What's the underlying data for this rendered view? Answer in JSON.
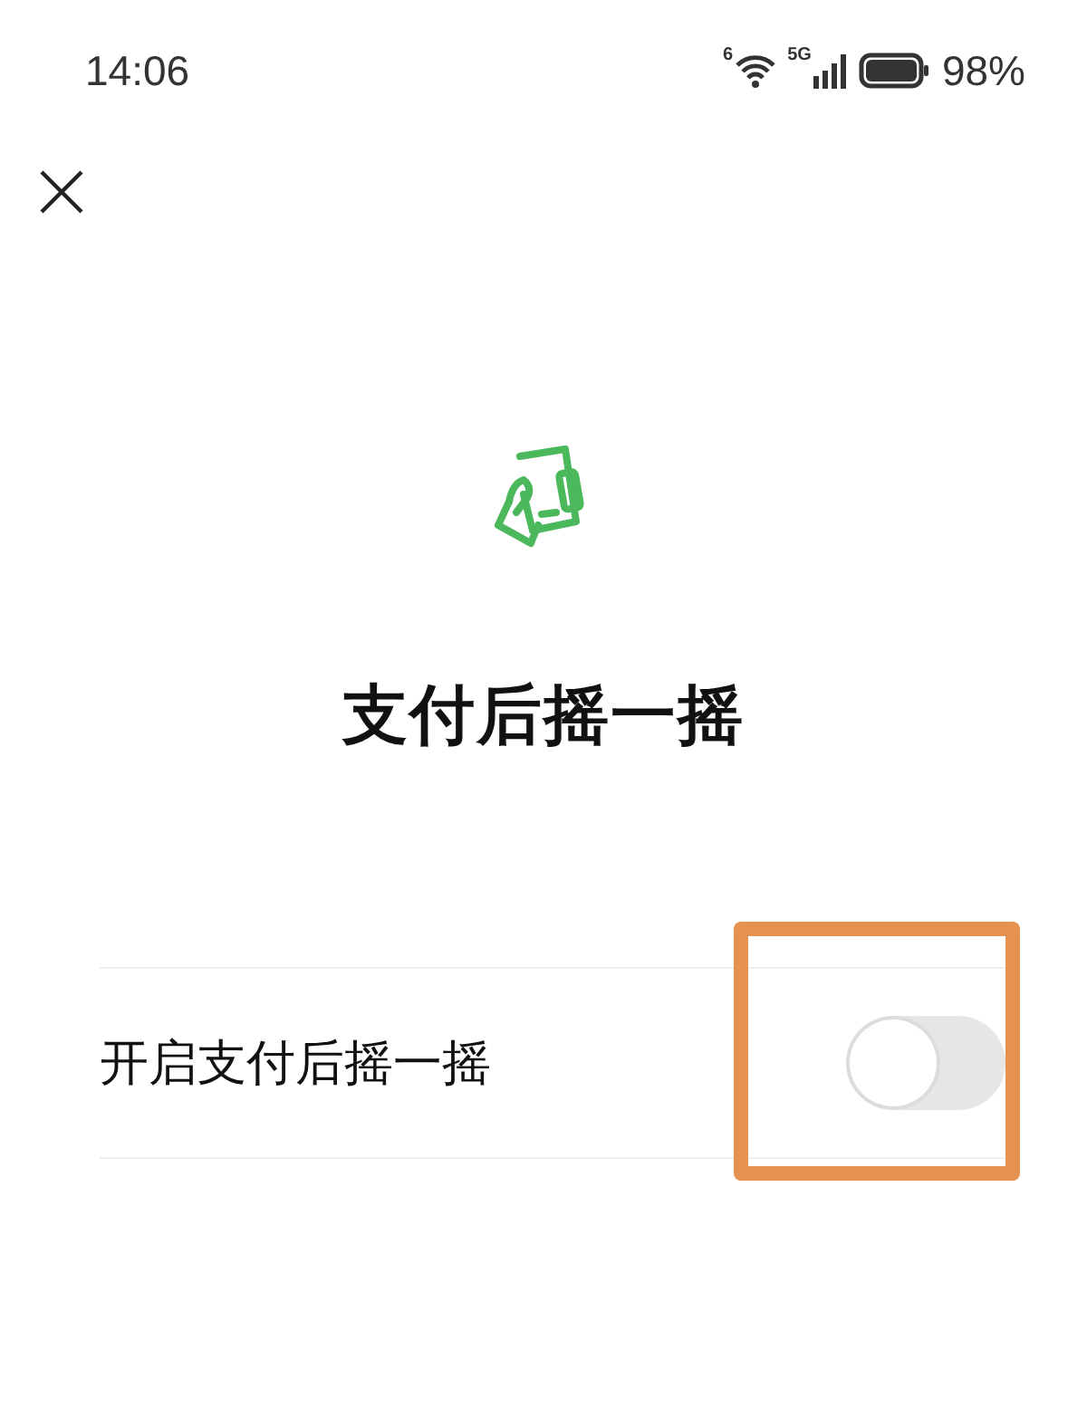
{
  "status_bar": {
    "time": "14:06",
    "wifi_label": "6",
    "network": "5G",
    "battery": "98%"
  },
  "page": {
    "title": "支付后摇一摇"
  },
  "settings": [
    {
      "label": "开启支付后摇一摇",
      "kind": "toggle",
      "on": false,
      "highlighted": true
    }
  ]
}
